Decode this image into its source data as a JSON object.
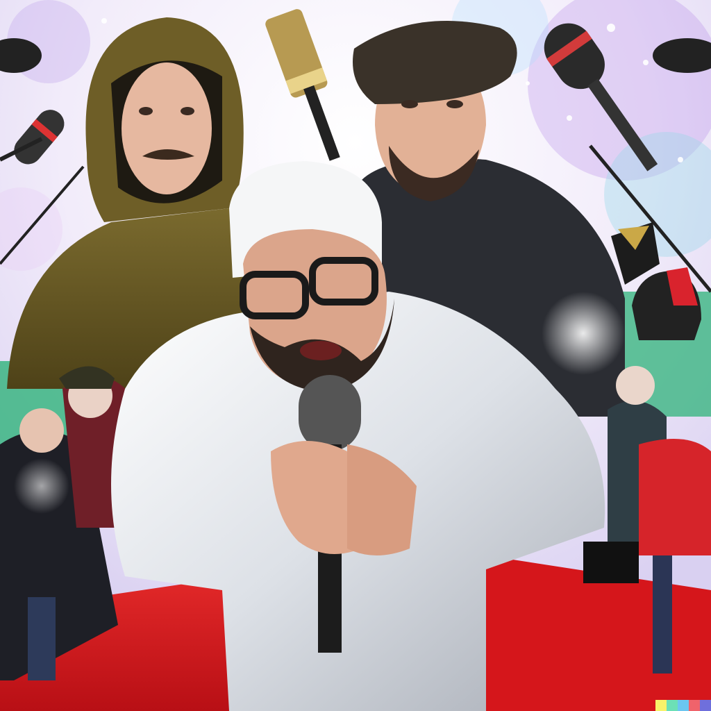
{
  "image": {
    "colors": {
      "stage_red": "#d5161b",
      "backdrop_white": "#f8f6fb",
      "sparkle_purple": "#b58ae8",
      "sparkle_cyan": "#7fd3e6",
      "hood_olive": "#6b5a24",
      "jacket_black": "#2b2d33",
      "suit_silver": "#e7e9ee",
      "cap_white": "#f5f6f7",
      "crowd_teal": "#2fb37a",
      "brand_bar": [
        "#f8f26a",
        "#6ce0b6",
        "#6bc6f0",
        "#f0636b",
        "#6f6fdc"
      ]
    }
  }
}
